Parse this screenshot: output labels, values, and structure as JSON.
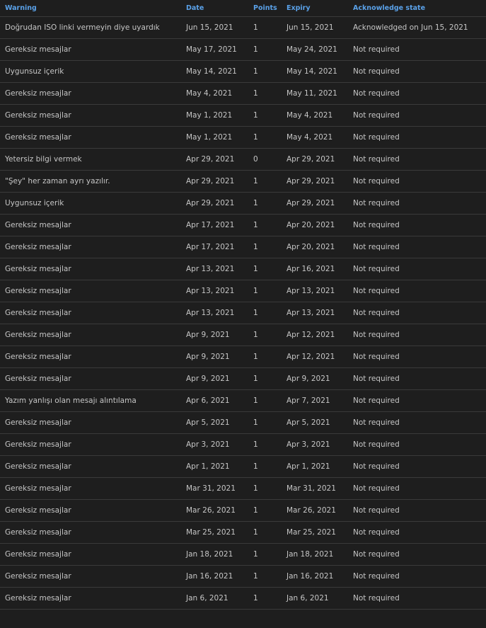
{
  "table": {
    "columns": [
      "Warning",
      "Date",
      "Points",
      "Expiry",
      "Acknowledge state"
    ],
    "rows": [
      [
        "Doğrudan ISO linki vermeyin diye uyardık",
        "Jun 15, 2021",
        "1",
        "Jun 15, 2021",
        "Acknowledged on Jun 15, 2021"
      ],
      [
        "Gereksiz mesajlar",
        "May 17, 2021",
        "1",
        "May 24, 2021",
        "Not required"
      ],
      [
        "Uygunsuz içerik",
        "May 14, 2021",
        "1",
        "May 14, 2021",
        "Not required"
      ],
      [
        "Gereksiz mesajlar",
        "May 4, 2021",
        "1",
        "May 11, 2021",
        "Not required"
      ],
      [
        "Gereksiz mesajlar",
        "May 1, 2021",
        "1",
        "May 4, 2021",
        "Not required"
      ],
      [
        "Gereksiz mesajlar",
        "May 1, 2021",
        "1",
        "May 4, 2021",
        "Not required"
      ],
      [
        "Yetersiz bilgi vermek",
        "Apr 29, 2021",
        "0",
        "Apr 29, 2021",
        "Not required"
      ],
      [
        "\"Şey\" her zaman ayrı yazılır.",
        "Apr 29, 2021",
        "1",
        "Apr 29, 2021",
        "Not required"
      ],
      [
        "Uygunsuz içerik",
        "Apr 29, 2021",
        "1",
        "Apr 29, 2021",
        "Not required"
      ],
      [
        "Gereksiz mesajlar",
        "Apr 17, 2021",
        "1",
        "Apr 20, 2021",
        "Not required"
      ],
      [
        "Gereksiz mesajlar",
        "Apr 17, 2021",
        "1",
        "Apr 20, 2021",
        "Not required"
      ],
      [
        "Gereksiz mesajlar",
        "Apr 13, 2021",
        "1",
        "Apr 16, 2021",
        "Not required"
      ],
      [
        "Gereksiz mesajlar",
        "Apr 13, 2021",
        "1",
        "Apr 13, 2021",
        "Not required"
      ],
      [
        "Gereksiz mesajlar",
        "Apr 13, 2021",
        "1",
        "Apr 13, 2021",
        "Not required"
      ],
      [
        "Gereksiz mesajlar",
        "Apr 9, 2021",
        "1",
        "Apr 12, 2021",
        "Not required"
      ],
      [
        "Gereksiz mesajlar",
        "Apr 9, 2021",
        "1",
        "Apr 12, 2021",
        "Not required"
      ],
      [
        "Gereksiz mesajlar",
        "Apr 9, 2021",
        "1",
        "Apr 9, 2021",
        "Not required"
      ],
      [
        "Yazım yanlışı olan mesajı alıntılama",
        "Apr 6, 2021",
        "1",
        "Apr 7, 2021",
        "Not required"
      ],
      [
        "Gereksiz mesajlar",
        "Apr 5, 2021",
        "1",
        "Apr 5, 2021",
        "Not required"
      ],
      [
        "Gereksiz mesajlar",
        "Apr 3, 2021",
        "1",
        "Apr 3, 2021",
        "Not required"
      ],
      [
        "Gereksiz mesajlar",
        "Apr 1, 2021",
        "1",
        "Apr 1, 2021",
        "Not required"
      ],
      [
        "Gereksiz mesajlar",
        "Mar 31, 2021",
        "1",
        "Mar 31, 2021",
        "Not required"
      ],
      [
        "Gereksiz mesajlar",
        "Mar 26, 2021",
        "1",
        "Mar 26, 2021",
        "Not required"
      ],
      [
        "Gereksiz mesajlar",
        "Mar 25, 2021",
        "1",
        "Mar 25, 2021",
        "Not required"
      ],
      [
        "Gereksiz mesajlar",
        "Jan 18, 2021",
        "1",
        "Jan 18, 2021",
        "Not required"
      ],
      [
        "Gereksiz mesajlar",
        "Jan 16, 2021",
        "1",
        "Jan 16, 2021",
        "Not required"
      ],
      [
        "Gereksiz mesajlar",
        "Jan 6, 2021",
        "1",
        "Jan 6, 2021",
        "Not required"
      ]
    ]
  },
  "colors": {
    "background": "#1e1e1e",
    "header_text": "#5aa1e8",
    "cell_text": "#c6c6c6",
    "row_divider": "#3a3a3a"
  }
}
